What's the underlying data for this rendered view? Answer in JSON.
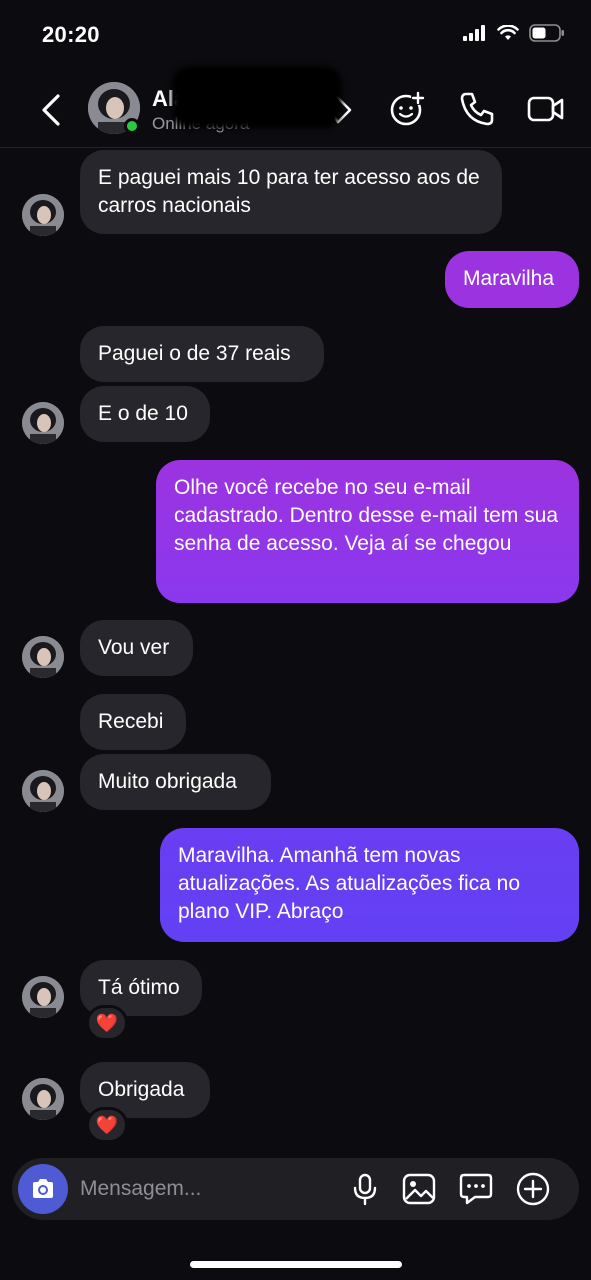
{
  "status_bar": {
    "time": "20:20"
  },
  "header": {
    "contact_name": "Ala",
    "contact_status": "Online agora"
  },
  "messages": [
    {
      "side": "incoming",
      "text": "E paguei mais 10 para ter acesso aos de carros nacionais"
    },
    {
      "side": "outgoing",
      "text": "Maravilha"
    },
    {
      "side": "incoming",
      "text": "Paguei o de 37 reais"
    },
    {
      "side": "incoming",
      "text": "E o de 10"
    },
    {
      "side": "outgoing",
      "text": "Olhe você recebe no seu e-mail cadastrado. Dentro desse e-mail tem sua senha de acesso. Veja aí se chegou"
    },
    {
      "side": "incoming",
      "text": "Vou ver"
    },
    {
      "side": "incoming",
      "text": "Recebi"
    },
    {
      "side": "incoming",
      "text": "Muito obrigada"
    },
    {
      "side": "outgoing",
      "text": "Maravilha. Amanhã tem novas atualizações. As atualizações fica no plano VIP. Abraço"
    },
    {
      "side": "incoming",
      "text": "Tá ótimo",
      "reaction": "❤️"
    },
    {
      "side": "incoming",
      "text": "Obrigada",
      "reaction": "❤️"
    }
  ],
  "composer": {
    "placeholder": "Mensagem..."
  },
  "colors": {
    "background": "#0c0c10",
    "incoming_bubble": "#26262c",
    "outgoing_purple": "#9b34e0",
    "outgoing_violet": "#6a3df0",
    "online": "#2ac940",
    "camera": "#4f5bd5"
  },
  "icons": [
    "back-icon",
    "tag-icon",
    "sticker-add-icon",
    "phone-icon",
    "video-icon",
    "camera-icon",
    "mic-icon",
    "image-icon",
    "chat-bubble-icon",
    "plus-icon",
    "signal-icon",
    "wifi-icon",
    "battery-icon"
  ]
}
